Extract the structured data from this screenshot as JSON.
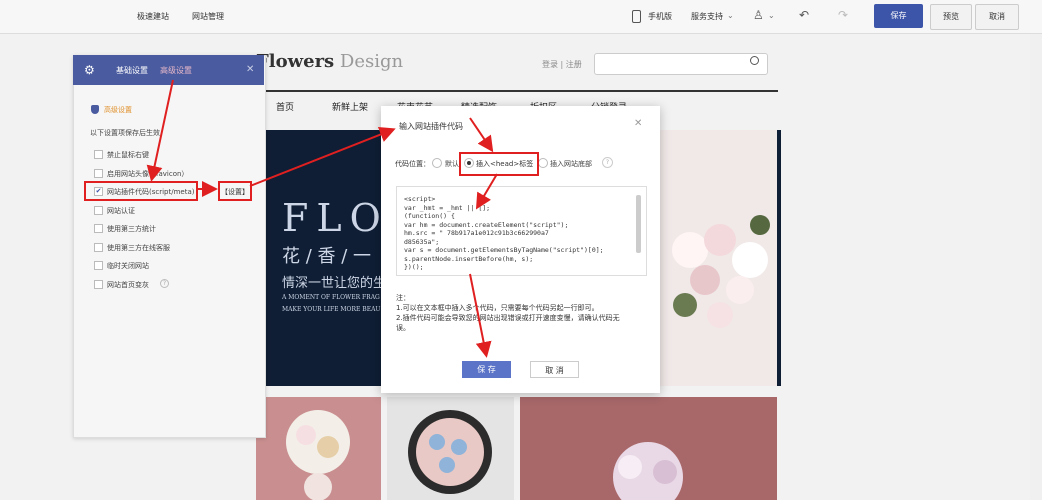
{
  "topbar": {
    "links": [
      "极速建站",
      "网站管理"
    ],
    "mobile": "手机版",
    "support": "服务支持",
    "save": "保存",
    "preview": "预览",
    "cancel": "取消"
  },
  "site": {
    "brand_main": "Flowers",
    "brand_sub": " Design",
    "login": "登录 | 注册",
    "nav": [
      "首页",
      "新鲜上架",
      "花束花艺",
      "精选配饰",
      "折扣区",
      "分销登录"
    ],
    "banner": {
      "big": "FLOW",
      "cn1": "花 / 香 / 一",
      "cn2": "情深一世让您的生",
      "en1": "A MOMENT OF FLOWER FRAG",
      "en2": "MAKE YOUR LIFE MORE BEAU"
    }
  },
  "panel": {
    "tab_basic": "基础设置",
    "tab_advanced": "高级设置",
    "section": "高级设置",
    "hint": "以下设置项保存后生效",
    "options": [
      {
        "label": "禁止鼠标右键",
        "checked": false
      },
      {
        "label": "启用网站头像（favicon）",
        "checked": false
      },
      {
        "label": "网站插件代码(script/meta)",
        "checked": true
      },
      {
        "label": "网站认证",
        "checked": false
      },
      {
        "label": "使用第三方统计",
        "checked": false
      },
      {
        "label": "使用第三方在线客服",
        "checked": false
      },
      {
        "label": "临时关闭网站",
        "checked": false
      },
      {
        "label": "网站首页变灰",
        "checked": false
      }
    ],
    "settings_link": "【设置】"
  },
  "modal": {
    "title": "输入网站插件代码",
    "position_label": "代码位置：",
    "opt_default": "默认",
    "opt_head": "插入<head>标签",
    "opt_bottom": "插入网站底部",
    "help": "?",
    "code_lines": [
      "<script>",
      "var _hmt = _hmt || [];",
      "(function() {",
      "  var hm = document.createElement(\"script\");",
      "  hm.src = \"                     78b917a1e012c91b3c662990a7",
      "d85635a\";",
      "  var s = document.getElementsByTagName(\"script\")[0];",
      "  s.parentNode.insertBefore(hm, s);",
      "})();"
    ],
    "note_title": "注：",
    "note1": "1.可以在文本框中插入多个代码，只需要每个代码另起一行即可。",
    "note2": "2.插件代码可能会导致您的网站出现错误或打开速度变慢，请确认代码无",
    "note3": "误。",
    "save": "保 存",
    "cancel": "取 消"
  },
  "colors": {
    "accent": "#3d55a8",
    "annotation": "#e02020"
  }
}
